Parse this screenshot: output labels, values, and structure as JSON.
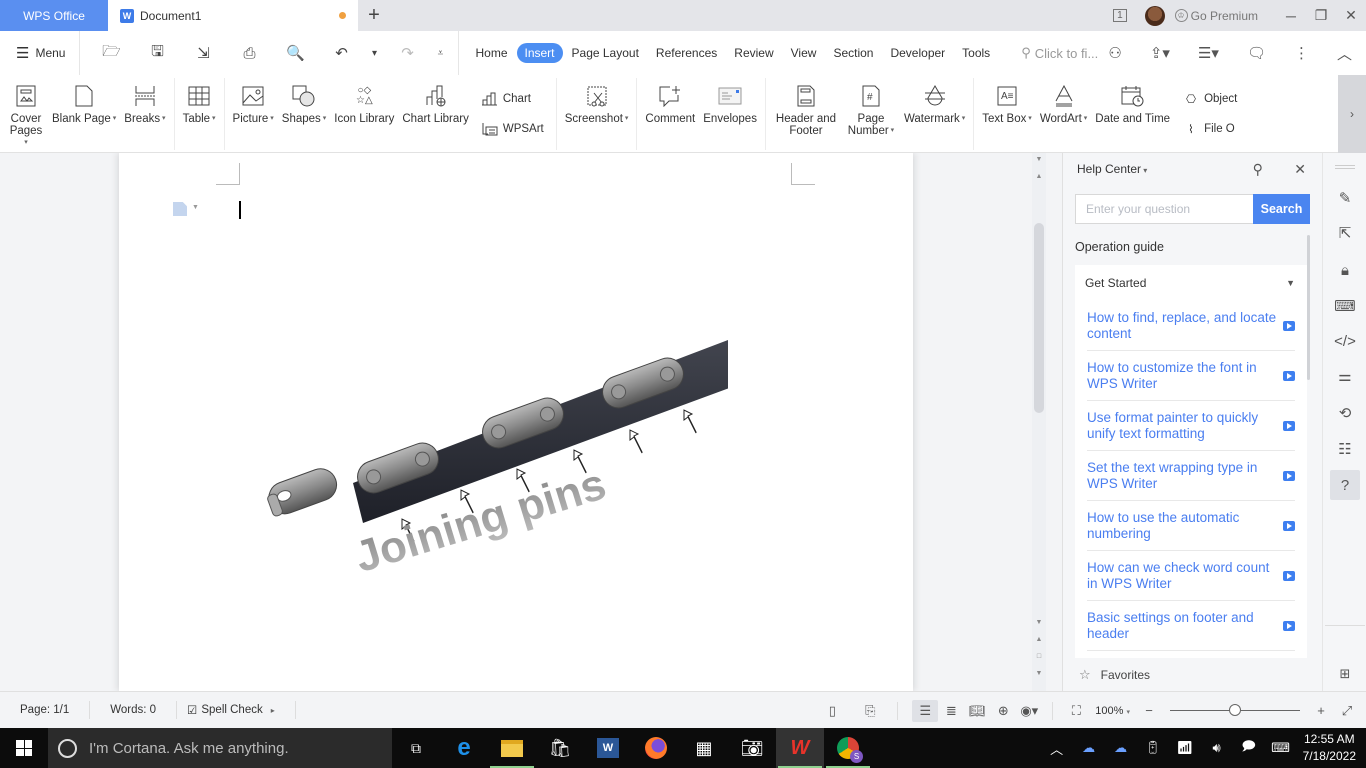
{
  "titlebar": {
    "home_tab": "WPS Office",
    "doc_tab": "Document1",
    "new_tab_icon": "+",
    "go_premium": "Go Premium",
    "window_count": "1"
  },
  "menubar": {
    "menu_label": "Menu",
    "tabs": [
      "Home",
      "Insert",
      "Page Layout",
      "References",
      "Review",
      "View",
      "Section",
      "Developer",
      "Tools"
    ],
    "active_tab": "Insert",
    "search_placeholder": "Click to fi..."
  },
  "ribbon": {
    "cover_pages": "Cover Pages",
    "blank_page": "Blank Page",
    "breaks": "Breaks",
    "table": "Table",
    "picture": "Picture",
    "shapes": "Shapes",
    "icon_library": "Icon Library",
    "chart_library": "Chart Library",
    "chart": "Chart",
    "wpsart": "WPSArt",
    "screenshot": "Screenshot",
    "comment": "Comment",
    "envelopes": "Envelopes",
    "header_footer": "Header and Footer",
    "page_number": "Page Number",
    "watermark": "Watermark",
    "text_box": "Text Box",
    "wordart": "WordArt",
    "date_time": "Date and Time",
    "object": "Object",
    "file_object": "File O"
  },
  "document": {
    "image_caption": "Joining pins",
    "image_alt": "Bicycle chain with arrows pointing to joining pins"
  },
  "help_center": {
    "title": "Help Center",
    "search_placeholder": "Enter your question",
    "search_button": "Search",
    "section_title": "Operation guide",
    "category": "Get Started",
    "items": [
      "How to find, replace, and locate content",
      "How to customize the font in WPS Writer",
      "Use format painter to quickly unify text formatting",
      "Set the text wrapping type in WPS Writer",
      "How to use the automatic numbering",
      "How can we check word count in WPS Writer",
      "Basic settings on footer and header"
    ],
    "favorites": "Favorites"
  },
  "statusbar": {
    "page": "Page: 1/1",
    "words": "Words: 0",
    "spell_check": "Spell Check",
    "zoom_level": "100%",
    "zoom_fraction": 0.5
  },
  "taskbar": {
    "cortana_placeholder": "I'm Cortana. Ask me anything.",
    "time": "12:55 AM",
    "date": "7/18/2022"
  },
  "colors": {
    "accent": "#4c8ef2",
    "home_tab": "#5a8ff0",
    "link": "#4a7ef0",
    "unsaved_dot": "#f0a040"
  }
}
